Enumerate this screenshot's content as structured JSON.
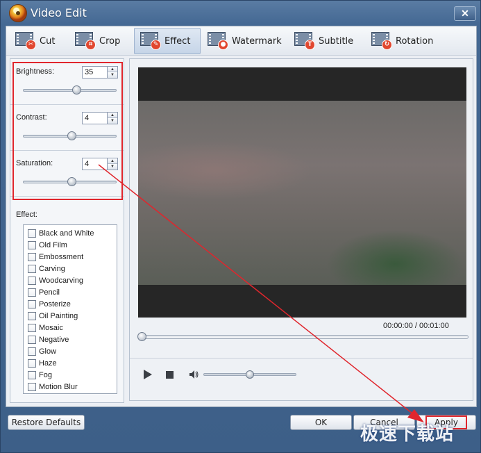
{
  "window": {
    "title": "Video Edit",
    "close_glyph": "✕"
  },
  "tabs": [
    {
      "label": "Cut",
      "icon": "scissors-icon",
      "badge": "✂"
    },
    {
      "label": "Crop",
      "icon": "crop-icon",
      "badge": "⌗"
    },
    {
      "label": "Effect",
      "icon": "effect-icon",
      "badge": "✎",
      "active": true
    },
    {
      "label": "Watermark",
      "icon": "watermark-icon",
      "badge": "●"
    },
    {
      "label": "Subtitle",
      "icon": "subtitle-icon",
      "badge": "T"
    },
    {
      "label": "Rotation",
      "icon": "rotation-icon",
      "badge": "↻"
    }
  ],
  "adjustments": {
    "brightness": {
      "label": "Brightness:",
      "value": "35",
      "level": 0.57
    },
    "contrast": {
      "label": "Contrast:",
      "value": "4",
      "level": 0.52
    },
    "saturation": {
      "label": "Saturation:",
      "value": "4",
      "level": 0.52
    }
  },
  "effects": {
    "label": "Effect:",
    "items": [
      "Black and White",
      "Old Film",
      "Embossment",
      "Carving",
      "Woodcarving",
      "Pencil",
      "Posterize",
      "Oil Painting",
      "Mosaic",
      "Negative",
      "Glow",
      "Haze",
      "Fog",
      "Motion Blur"
    ]
  },
  "player": {
    "time_current": "00:00:00",
    "time_separator": "/",
    "time_total": "00:01:00",
    "progress": 0,
    "volume": 0.5
  },
  "buttons": {
    "restore_defaults": "Restore Defaults",
    "ok": "OK",
    "cancel": "Cancel",
    "apply": "Apply"
  },
  "watermark_text": "极速下载站",
  "colors": {
    "highlight": "#e0262d",
    "title_bar": "#446893"
  }
}
